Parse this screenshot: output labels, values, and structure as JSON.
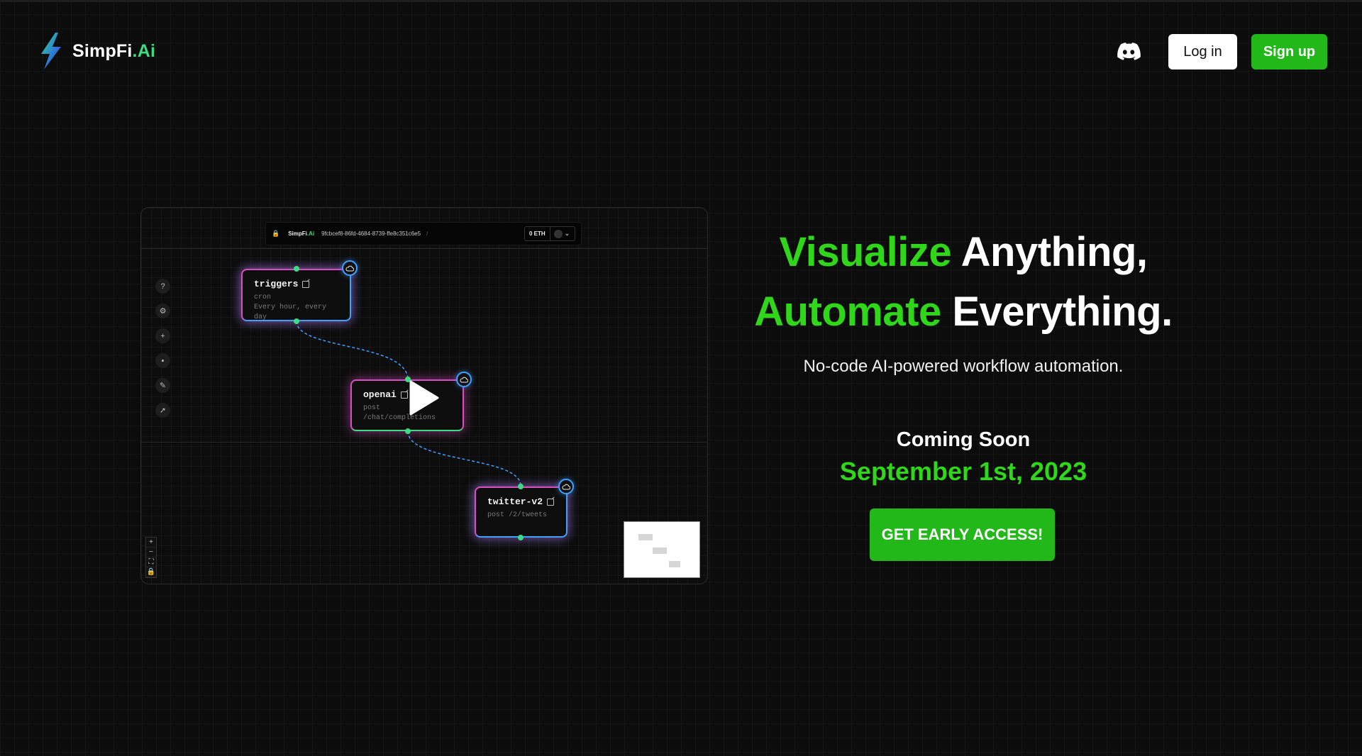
{
  "header": {
    "logo_brand": "SimpFi",
    "logo_accent": ".Ai",
    "discord_icon": "discord-icon",
    "login_label": "Log in",
    "signup_label": "Sign up"
  },
  "preview": {
    "topbar": {
      "brand": "SimpFi",
      "brand_accent": ".Ai",
      "workflow_id": "9fcbcef8-86fd-4684-8739-ffe8c351c6e5",
      "separator": "/",
      "balance": "0 ETH"
    },
    "nodes": [
      {
        "title": "triggers",
        "lines": [
          "cron",
          "Every hour, every day"
        ]
      },
      {
        "title": "openai",
        "lines": [
          "post /chat/completions"
        ]
      },
      {
        "title": "twitter-v2",
        "lines": [
          "post /2/tweets"
        ]
      }
    ],
    "zoom_controls": [
      "+",
      "−",
      "⛶",
      "🔒"
    ]
  },
  "hero": {
    "line1_accent": "Visualize",
    "line1_rest": " Anything,",
    "line2_accent": "Automate",
    "line2_rest": " Everything.",
    "tagline": "No-code AI-powered workflow automation.",
    "coming_soon": "Coming Soon",
    "date": "September 1st, 2023",
    "cta_label": "GET EARLY ACCESS!"
  },
  "colors": {
    "accent_green": "#2fd61a",
    "button_green": "#23b81a",
    "background": "#0c0c0c",
    "node_pink": "#d84fc2",
    "node_blue": "#3fa0ff"
  }
}
